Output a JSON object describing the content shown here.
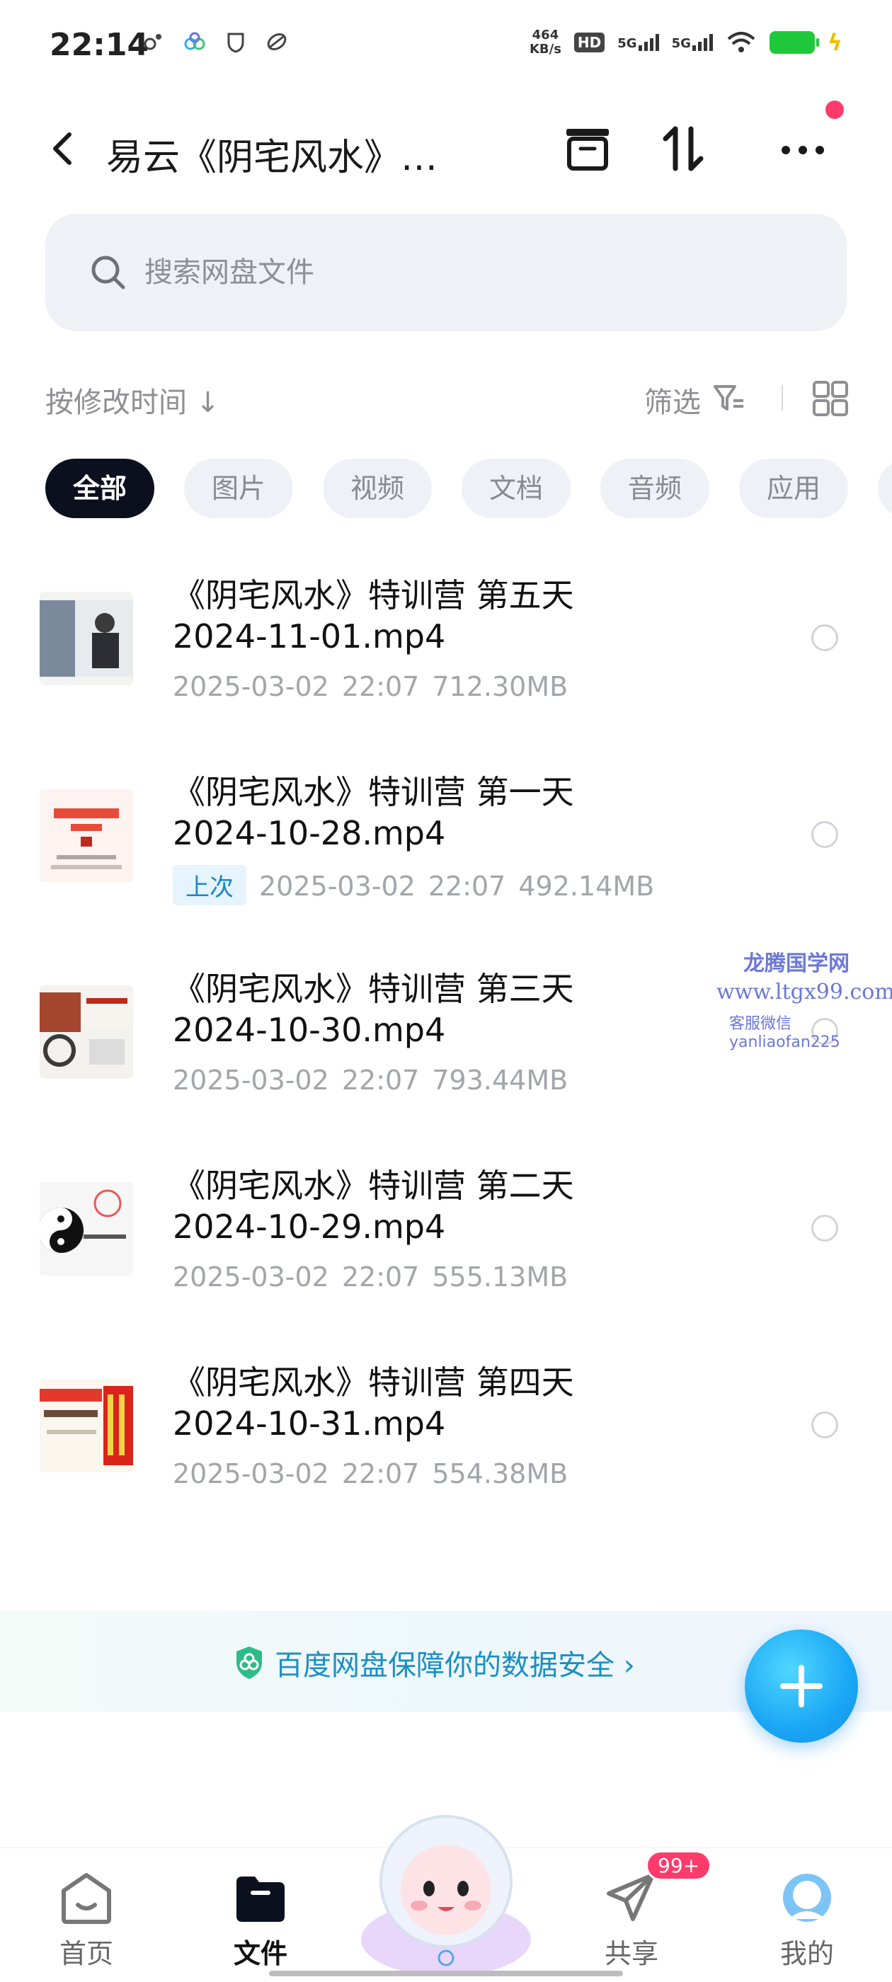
{
  "status_bar": {
    "time": "22:14",
    "net_speed_value": "464",
    "net_speed_unit": "KB/s",
    "hd": "HD",
    "sim1": "5G",
    "sim2": "5G"
  },
  "header": {
    "title": "易云《阴宅风水》…",
    "back_icon": "chevron-left-icon",
    "archive_icon": "archive-icon",
    "sort_icon": "sort-arrows-icon",
    "more_icon": "more-icon"
  },
  "search": {
    "placeholder": "搜索网盘文件"
  },
  "sort": {
    "label": "按修改时间 ↓",
    "filter_label": "筛选"
  },
  "categories": [
    "全部",
    "图片",
    "视频",
    "文档",
    "音频",
    "应用"
  ],
  "files": [
    {
      "name_line1": "《阴宅风水》特训营 第五天",
      "name_line2": "2024-11-01.mp4",
      "date": "2025-03-02",
      "time": "22:07",
      "size": "712.30MB",
      "badge": ""
    },
    {
      "name_line1": "《阴宅风水》特训营 第一天",
      "name_line2": "2024-10-28.mp4",
      "date": "2025-03-02",
      "time": "22:07",
      "size": "492.14MB",
      "badge": "上次"
    },
    {
      "name_line1": "《阴宅风水》特训营 第三天",
      "name_line2": "2024-10-30.mp4",
      "date": "2025-03-02",
      "time": "22:07",
      "size": "793.44MB",
      "badge": ""
    },
    {
      "name_line1": "《阴宅风水》特训营 第二天",
      "name_line2": "2024-10-29.mp4",
      "date": "2025-03-02",
      "time": "22:07",
      "size": "555.13MB",
      "badge": ""
    },
    {
      "name_line1": "《阴宅风水》特训营 第四天",
      "name_line2": "2024-10-31.mp4",
      "date": "2025-03-02",
      "time": "22:07",
      "size": "554.38MB",
      "badge": ""
    }
  ],
  "watermark": {
    "line1": "龙腾国学网",
    "line2": "www.ltgx99.com",
    "line3": "客服微信 yanliaofan225"
  },
  "security_banner": {
    "text": "百度网盘保障你的数据安全 ›"
  },
  "bottom_nav": {
    "items": [
      {
        "label": "首页"
      },
      {
        "label": "文件"
      },
      {
        "label": "共享"
      },
      {
        "label": "我的"
      }
    ],
    "share_badge": "99+"
  },
  "colors": {
    "accent": "#1aa6f5",
    "chip_active": "#0b0f1e",
    "badge_red": "#ff3b6b",
    "link": "#1a8fc4"
  }
}
